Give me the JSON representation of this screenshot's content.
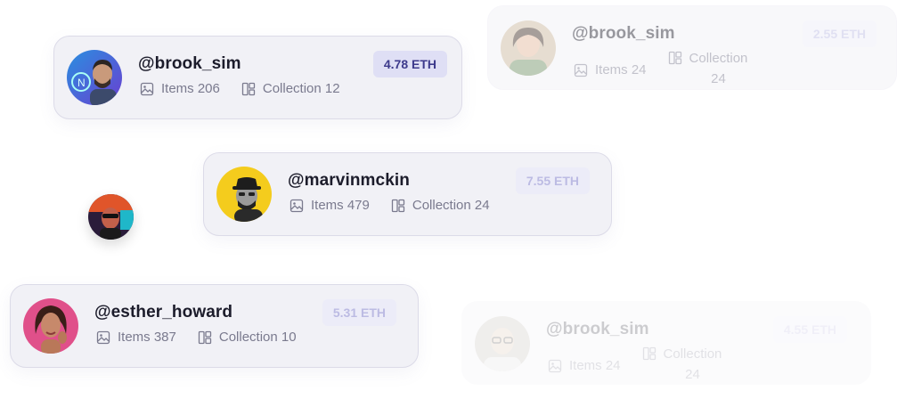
{
  "cards": [
    {
      "handle": "@brook_sim",
      "items_label": "Items 206",
      "collection_label": "Collection 12",
      "price": "4.78 ETH",
      "avatar": "man-neon-avatar"
    },
    {
      "handle": "@marvinmckin",
      "items_label": "Items 479",
      "collection_label": "Collection 24",
      "price": "7.55 ETH",
      "avatar": "man-hat-avatar"
    },
    {
      "handle": "@esther_howard",
      "items_label": "Items 387",
      "collection_label": "Collection 10",
      "price": "5.31 ETH",
      "avatar": "woman-pink-avatar"
    },
    {
      "handle": "@brook_sim",
      "items_label": "Items 24",
      "collection_label": "Collection",
      "collection_count": "24",
      "price": "2.55 ETH",
      "avatar": "woman-avatar"
    },
    {
      "handle": "@brook_sim",
      "items_label": "Items 24",
      "collection_label": "Collection",
      "collection_count": "24",
      "price": "4.55 ETH",
      "avatar": "man-glasses-avatar"
    }
  ],
  "floating_avatar": "man-neon-glasses-avatar",
  "icons": {
    "items": "image-icon",
    "collection": "collection-icon"
  },
  "colors": {
    "card_bg": "#f1f1f6",
    "price_bg": "#dfdff5",
    "price_text": "#3d3a8c",
    "handle_text": "#1c1c2b",
    "meta_text": "#7a7a8e"
  }
}
